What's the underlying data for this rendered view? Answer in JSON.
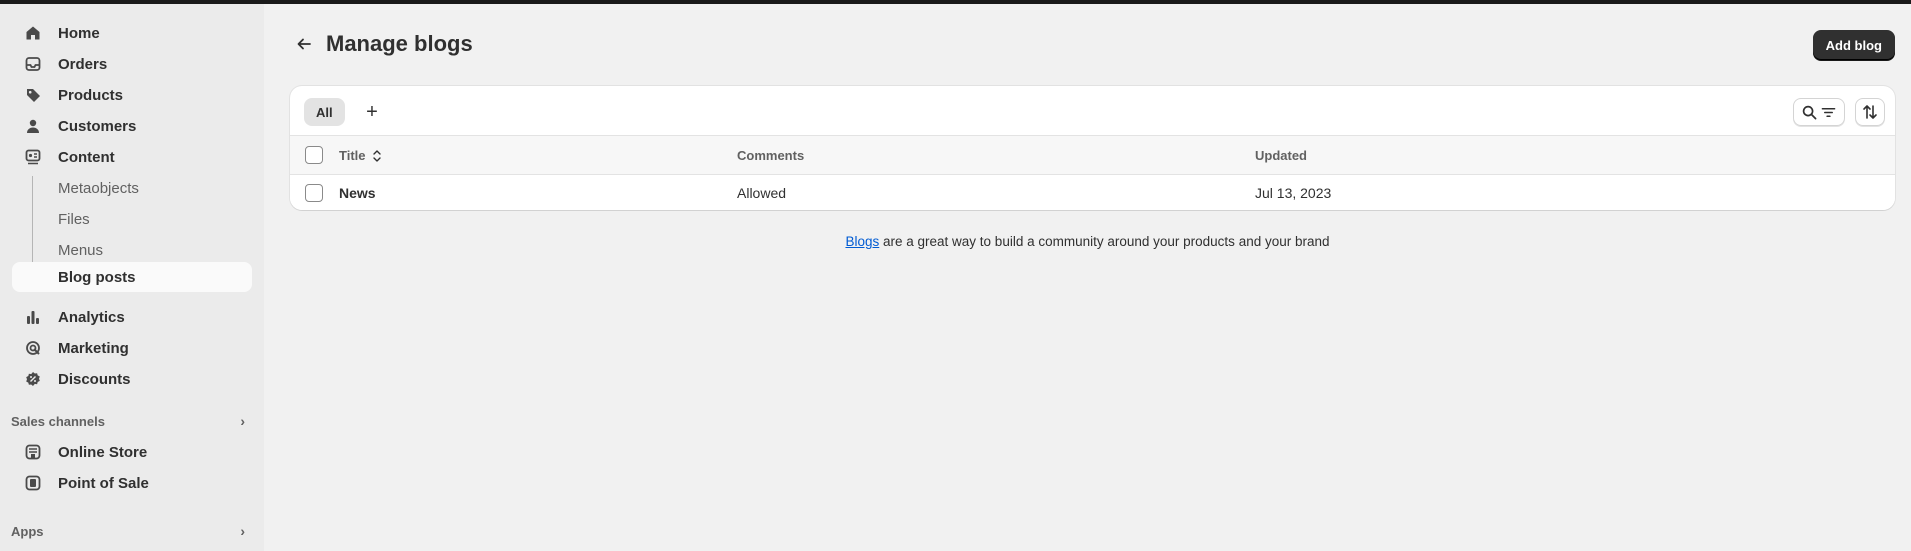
{
  "sidebar": {
    "items": [
      {
        "label": "Home",
        "icon": "home-icon"
      },
      {
        "label": "Orders",
        "icon": "inbox-icon"
      },
      {
        "label": "Products",
        "icon": "tag-icon"
      },
      {
        "label": "Customers",
        "icon": "person-icon"
      },
      {
        "label": "Content",
        "icon": "content-icon"
      }
    ],
    "content_sub": [
      "Metaobjects",
      "Files",
      "Menus",
      "Blog posts"
    ],
    "more_items": [
      {
        "label": "Analytics",
        "icon": "bar-chart-icon"
      },
      {
        "label": "Marketing",
        "icon": "target-icon"
      },
      {
        "label": "Discounts",
        "icon": "discount-icon"
      }
    ],
    "sales_channels_label": "Sales channels",
    "channels": [
      {
        "label": "Online Store",
        "icon": "store-icon"
      },
      {
        "label": "Point of Sale",
        "icon": "pos-icon"
      }
    ],
    "apps_label": "Apps"
  },
  "header": {
    "title": "Manage blogs",
    "add_button": "Add blog"
  },
  "tabs": {
    "all_label": "All",
    "add_label": "+"
  },
  "table": {
    "columns": [
      "Title",
      "Comments",
      "Updated"
    ],
    "rows": [
      {
        "title": "News",
        "comments": "Allowed",
        "updated": "Jul 13, 2023"
      }
    ]
  },
  "footer": {
    "link_text": "Blogs",
    "rest_text": " are a great way to build a community around your products and your brand"
  },
  "colors": {
    "sidebar_bg": "#ebebeb",
    "page_bg": "#f1f1f1",
    "primary_button": "#303030",
    "link": "#005bd3"
  }
}
